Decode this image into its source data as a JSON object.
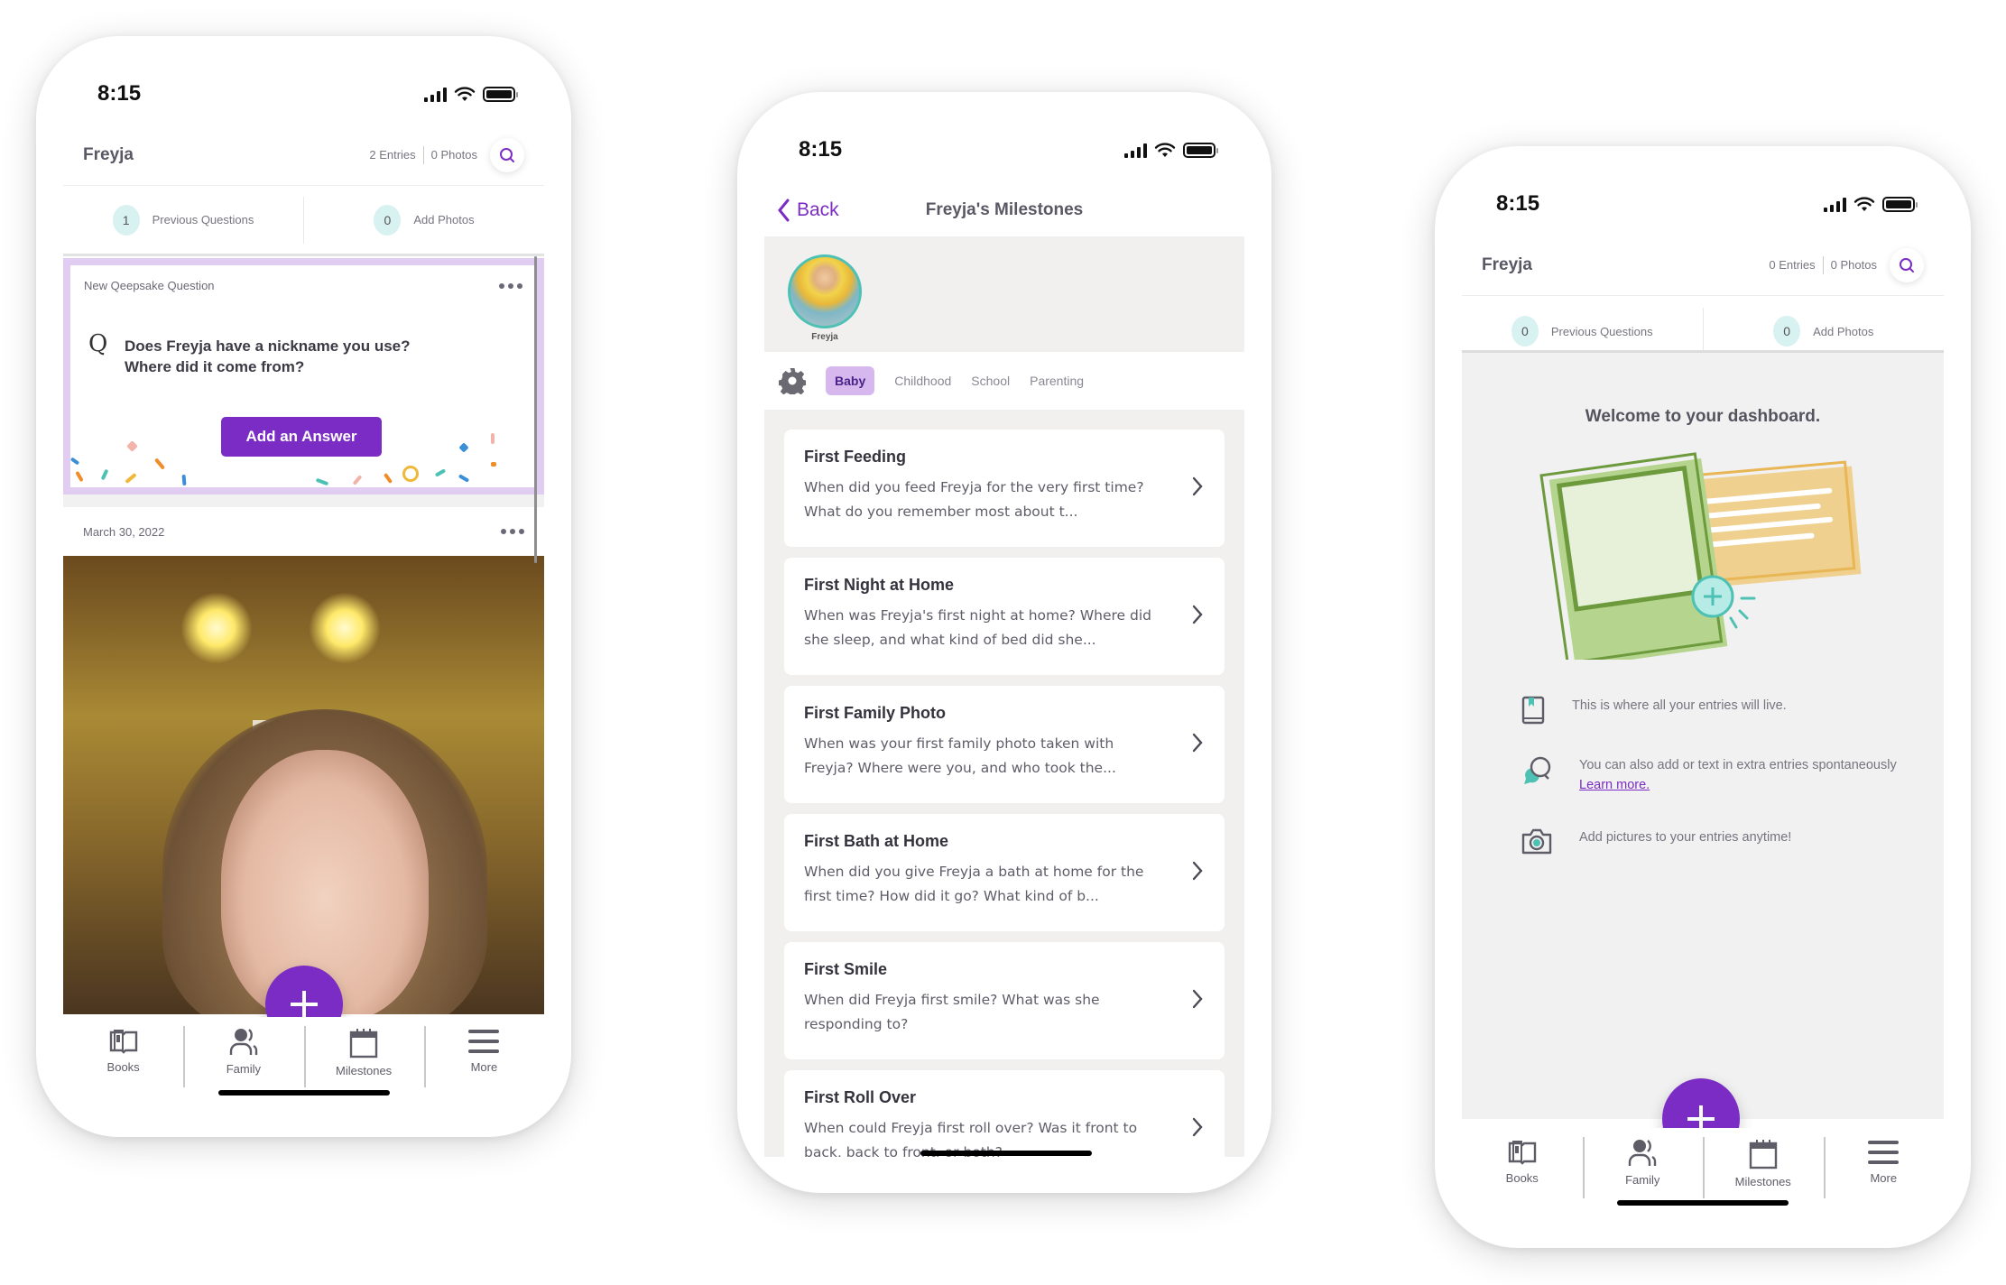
{
  "status_bar": {
    "time": "8:15"
  },
  "screen_feed": {
    "child_name": "Freyja",
    "entries_count": "2 Entries",
    "photos_count": "0 Photos",
    "previous_questions": {
      "count": "1",
      "label": "Previous Questions"
    },
    "add_photos": {
      "count": "0",
      "label": "Add Photos"
    },
    "question_card": {
      "label": "New Qeepsake Question",
      "question_line1": "Does Freyja have a nickname you use?",
      "question_line2": "Where did it come from?",
      "answer_button": "Add an Answer",
      "q_glyph": "Q"
    },
    "entry": {
      "date": "March 30, 2022"
    }
  },
  "tab_bar": {
    "tabs": [
      {
        "label": "Books",
        "icon": "open-book-icon"
      },
      {
        "label": "Family",
        "icon": "family-icon"
      },
      {
        "label": "Milestones",
        "icon": "calendar-icon"
      },
      {
        "label": "More",
        "icon": "hamburger-icon"
      }
    ],
    "fab_icon": "plus-icon"
  },
  "screen_milestones": {
    "back_label": "Back",
    "title": "Freyja's Milestones",
    "avatar_name": "Freyja",
    "categories": [
      {
        "label": "Baby",
        "active": true
      },
      {
        "label": "Childhood",
        "active": false
      },
      {
        "label": "School",
        "active": false
      },
      {
        "label": "Parenting",
        "active": false
      }
    ],
    "milestones": [
      {
        "title": "First Feeding",
        "desc": "When did you feed Freyja for the very first time? What do you remember most about t..."
      },
      {
        "title": "First Night at Home",
        "desc": "When was Freyja's first night at home? Where did she sleep, and what kind of bed did she..."
      },
      {
        "title": "First Family Photo",
        "desc": "When was your first family photo taken with Freyja? Where were you, and who took the..."
      },
      {
        "title": "First Bath at Home",
        "desc": "When did you give Freyja a bath at home for the first time? How did it go? What kind of b..."
      },
      {
        "title": "First Smile",
        "desc": "When did Freyja first smile? What was she responding to?"
      },
      {
        "title": "First Roll Over",
        "desc": "When could Freyja first roll over? Was it front to back, back to front, or both?"
      }
    ]
  },
  "screen_dashboard": {
    "child_name": "Freyja",
    "entries_count": "0 Entries",
    "photos_count": "0 Photos",
    "previous_questions": {
      "count": "0",
      "label": "Previous Questions"
    },
    "add_photos": {
      "count": "0",
      "label": "Add Photos"
    },
    "welcome": "Welcome to your dashboard.",
    "info_items": [
      {
        "icon": "book-icon",
        "text": "This is where all your entries will live."
      },
      {
        "icon": "chat-bubbles-icon",
        "text": "You can also add or text in extra entries spontaneously",
        "link": "Learn more."
      },
      {
        "icon": "camera-icon",
        "text": "Add pictures to your entries anytime!"
      }
    ]
  },
  "colors": {
    "accent": "#7b2cc4",
    "teal": "#4ec1b5",
    "badge_bg": "#d8f1f1",
    "card_border": "#e2cdf2"
  }
}
